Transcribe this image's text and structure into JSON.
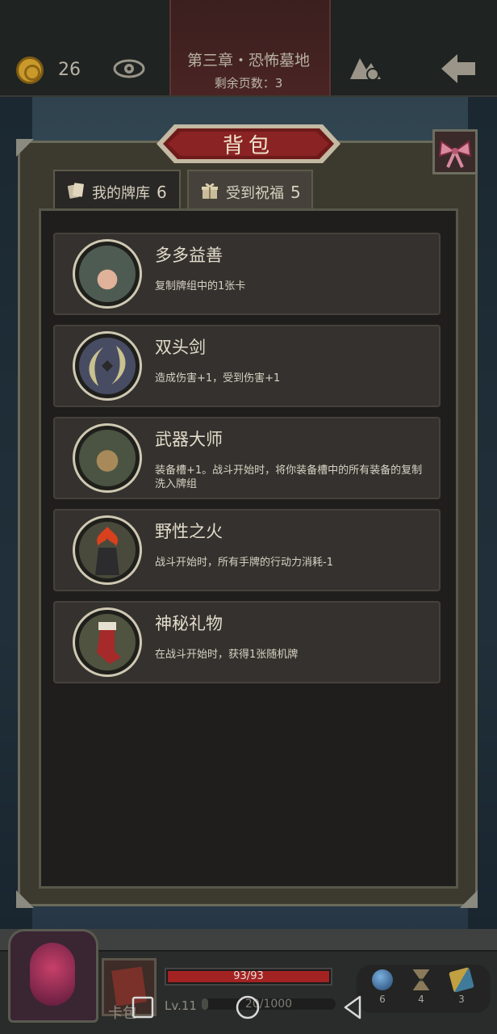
{
  "top_bar": {
    "coins": "26",
    "chapter_title": "第三章・恐怖墓地",
    "pages_left": "剩余页数：3"
  },
  "panel": {
    "title": "背包",
    "tabs": [
      {
        "label": "我的牌库",
        "count": "6",
        "active": false
      },
      {
        "label": "受到祝福",
        "count": "5",
        "active": true
      }
    ],
    "blessings": [
      {
        "name": "多多益善",
        "desc": "复制牌组中的1张卡",
        "icon": "hand-cards-icon"
      },
      {
        "name": "双头剑",
        "desc": "造成伤害+1，受到伤害+1",
        "icon": "double-blade-icon"
      },
      {
        "name": "武器大师",
        "desc": "装备槽+1。战斗开始时，将你装备槽中的所有装备的复制洗入牌组",
        "icon": "weapon-master-icon"
      },
      {
        "name": "野性之火",
        "desc": "战斗开始时，所有手牌的行动力消耗-1",
        "icon": "wild-fire-icon"
      },
      {
        "name": "神秘礼物",
        "desc": "在战斗开始时，获得1张随机牌",
        "icon": "stocking-gift-icon"
      }
    ]
  },
  "hud": {
    "deck_label": "卡包",
    "hp": "93/93",
    "hp_fraction": 1.0,
    "level": "Lv.11",
    "xp": "20/1000",
    "xp_fraction": 0.02,
    "resources": [
      {
        "icon": "orb-icon",
        "value": "6",
        "color": "#3f6ea8"
      },
      {
        "icon": "hourglass-icon",
        "value": "4",
        "color": "#a88a5a"
      },
      {
        "icon": "cards-icon",
        "value": "3",
        "color": "#c0a040"
      }
    ]
  }
}
